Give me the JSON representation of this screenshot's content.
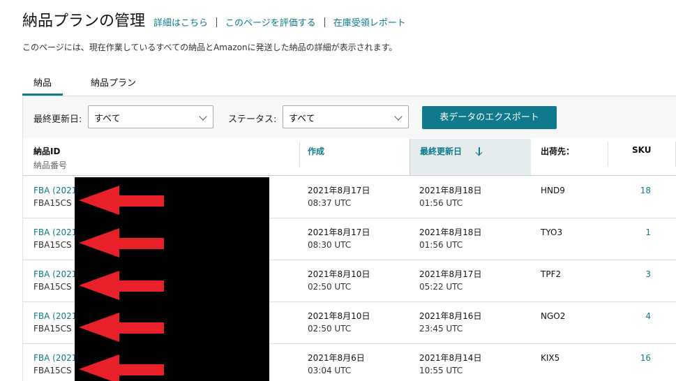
{
  "header": {
    "title": "納品プランの管理",
    "links": [
      "詳細はこちら",
      "このページを評価する",
      "在庫受領レポート"
    ],
    "description": "このページには、現在作業しているすべての納品とAmazonに発送した納品の詳細が表示されます。"
  },
  "tabs": [
    {
      "label": "納品",
      "active": true
    },
    {
      "label": "納品プラン",
      "active": false
    }
  ],
  "filters": {
    "updated_label": "最終更新日:",
    "updated_value": "すべて",
    "status_label": "ステータス:",
    "status_value": "すべて",
    "export_label": "表データのエクスポート"
  },
  "table": {
    "columns": {
      "id": "納品ID",
      "id_sub": "納品番号",
      "created": "作成",
      "updated": "最終更新日",
      "dest": "出荷先：",
      "sku": "SKU"
    },
    "rows": [
      {
        "id": "FBA (2021",
        "num": "FBA15CS",
        "created_date": "2021年8月17日",
        "created_time": "08:37 UTC",
        "updated_date": "2021年8月18日",
        "updated_time": "01:56 UTC",
        "dest": "HND9",
        "sku": "18"
      },
      {
        "id": "FBA (2021",
        "num": "FBA15CS",
        "created_date": "2021年8月17日",
        "created_time": "08:30 UTC",
        "updated_date": "2021年8月18日",
        "updated_time": "01:56 UTC",
        "dest": "TYO3",
        "sku": "1"
      },
      {
        "id": "FBA (2021",
        "num": "FBA15CS",
        "created_date": "2021年8月10日",
        "created_time": "02:50 UTC",
        "updated_date": "2021年8月17日",
        "updated_time": "05:22 UTC",
        "dest": "TPF2",
        "sku": "3"
      },
      {
        "id": "FBA (2021",
        "num": "FBA15CS",
        "created_date": "2021年8月10日",
        "created_time": "02:50 UTC",
        "updated_date": "2021年8月16日",
        "updated_time": "23:45 UTC",
        "dest": "NGO2",
        "sku": "4"
      },
      {
        "id": "FBA (2021",
        "num": "FBA15CS",
        "created_date": "2021年8月6日",
        "created_time": "03:04 UTC",
        "updated_date": "2021年8月14日",
        "updated_time": "10:55 UTC",
        "dest": "KIX5",
        "sku": "16"
      }
    ]
  },
  "colors": {
    "accent": "#0e7a8c",
    "sorted_header_bg": "#e4eced",
    "redaction": "#000000",
    "annotation_arrow": "#e8202a"
  }
}
